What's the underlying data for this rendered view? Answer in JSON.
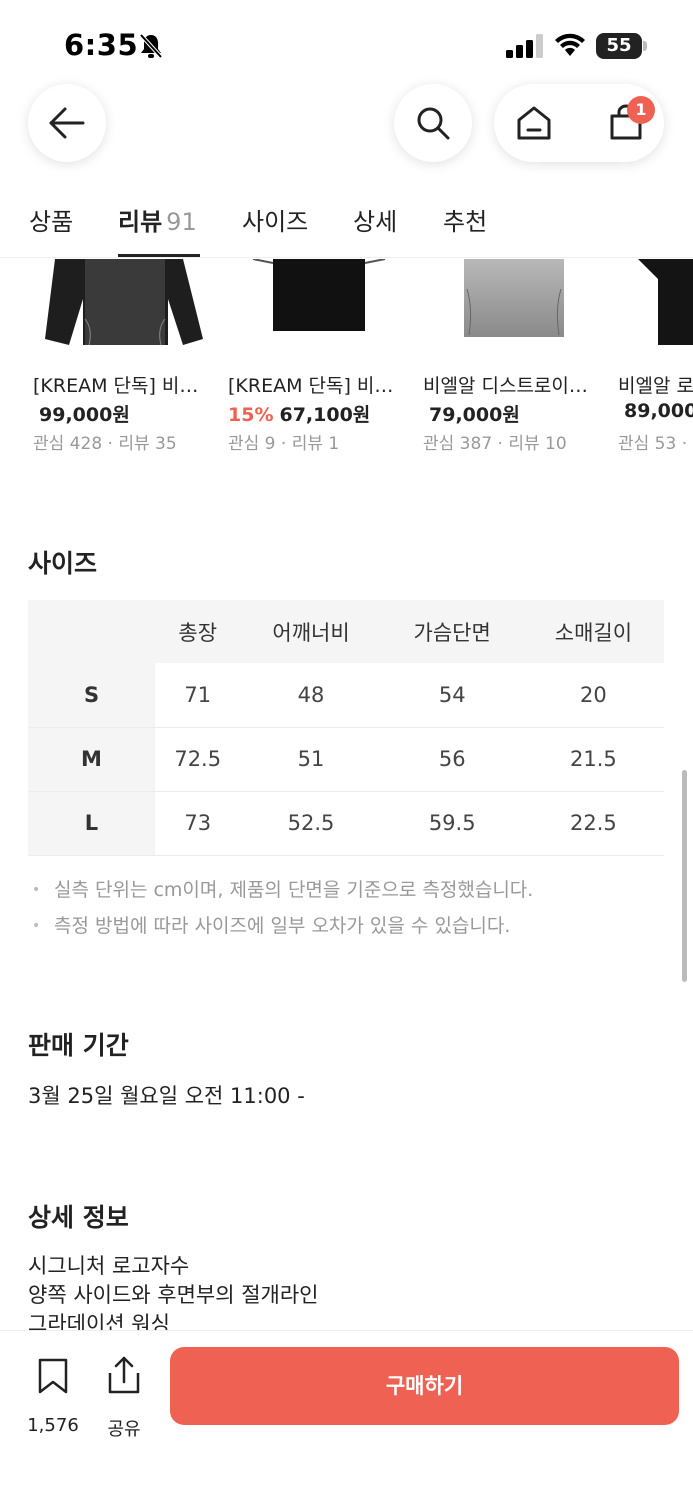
{
  "status_bar": {
    "time": "6:35",
    "battery": "55"
  },
  "header": {
    "cart_badge": "1"
  },
  "tabs": [
    {
      "label": "상품"
    },
    {
      "label": "리뷰",
      "count": "91"
    },
    {
      "label": "사이즈"
    },
    {
      "label": "상세"
    },
    {
      "label": "추천"
    }
  ],
  "products": [
    {
      "name": "[KREAM 단독] 비…",
      "discount": "",
      "price": "99,000원",
      "meta": "관심 428 · 리뷰 35"
    },
    {
      "name": "[KREAM 단독] 비…",
      "discount": "15%",
      "price": "67,100원",
      "meta": "관심 9 · 리뷰 1"
    },
    {
      "name": "비엘알 디스트로이…",
      "discount": "",
      "price": "79,000원",
      "meta": "관심 387 · 리뷰 10"
    },
    {
      "name": "비엘알 로",
      "discount": "",
      "price": "89,000",
      "meta": "관심 53 ·"
    }
  ],
  "size_section": {
    "title": "사이즈",
    "columns": [
      "총장",
      "어깨너비",
      "가슴단면",
      "소매길이"
    ],
    "rows": [
      {
        "size": "S",
        "values": [
          "71",
          "48",
          "54",
          "20"
        ]
      },
      {
        "size": "M",
        "values": [
          "72.5",
          "51",
          "56",
          "21.5"
        ]
      },
      {
        "size": "L",
        "values": [
          "73",
          "52.5",
          "59.5",
          "22.5"
        ]
      }
    ],
    "notes": [
      "실측 단위는 cm이며, 제품의 단면을 기준으로 측정했습니다.",
      "측정 방법에 따라 사이즈에 일부 오차가 있을 수 있습니다."
    ]
  },
  "sale_period": {
    "title": "판매 기간",
    "value": "3월 25일 월요일 오전 11:00 -"
  },
  "detail_info": {
    "title": "상세 정보",
    "lines": [
      "시그니처 로고자수",
      "양쪽 사이드와 후면부의 절개라인",
      "그라데이션 워싱"
    ]
  },
  "bottom_bar": {
    "bookmark_count": "1,576",
    "share_label": "공유",
    "buy_label": "구매하기"
  },
  "colors": {
    "accent": "#ef6253",
    "muted": "#999999"
  }
}
